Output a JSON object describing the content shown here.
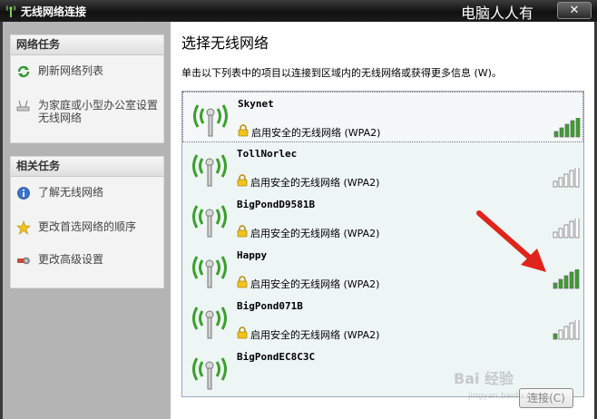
{
  "window": {
    "title": "无线网络连接",
    "watermark": "电脑人人有",
    "close_label": "✕"
  },
  "sidebar": {
    "network_tasks": {
      "header": "网络任务",
      "items": [
        {
          "label": "刷新网络列表",
          "icon": "refresh-icon"
        },
        {
          "label": "为家庭或小型办公室设置无线网络",
          "icon": "setup-network-icon"
        }
      ]
    },
    "related_tasks": {
      "header": "相关任务",
      "items": [
        {
          "label": "了解无线网络",
          "icon": "info-icon"
        },
        {
          "label": "更改首选网络的顺序",
          "icon": "star-icon"
        },
        {
          "label": "更改高级设置",
          "icon": "advanced-settings-icon"
        }
      ]
    }
  },
  "main": {
    "heading": "选择无线网络",
    "description": "单击以下列表中的项目以连接到区域内的无线网络或获得更多信息 (W)。",
    "connect_button": "连接(C)"
  },
  "networks": [
    {
      "ssid": "Skynet",
      "security": "启用安全的无线网络 (WPA2)",
      "signal_bars": 5,
      "selected": true
    },
    {
      "ssid": "TollNorlec",
      "security": "启用安全的无线网络 (WPA2)",
      "signal_bars": 0,
      "selected": false
    },
    {
      "ssid": "BigPondD9581B",
      "security": "启用安全的无线网络 (WPA2)",
      "signal_bars": 0,
      "selected": false
    },
    {
      "ssid": "Happy",
      "security": "启用安全的无线网络 (WPA2)",
      "signal_bars": 5,
      "selected": false
    },
    {
      "ssid": "BigPond071B",
      "security": "启用安全的无线网络 (WPA2)",
      "signal_bars": 1,
      "selected": false
    },
    {
      "ssid": "BigPondEC8C3C",
      "security": "",
      "signal_bars": 0,
      "selected": false
    }
  ],
  "overlay": {
    "baidu_logo": "Bai 经验",
    "baidu_url": "jingyan.baidu.com"
  },
  "colors": {
    "signal_on": "#3aa02c",
    "signal_off": "#ffffff",
    "arrow": "#e0241c",
    "row_bg": "#eef5f5"
  }
}
